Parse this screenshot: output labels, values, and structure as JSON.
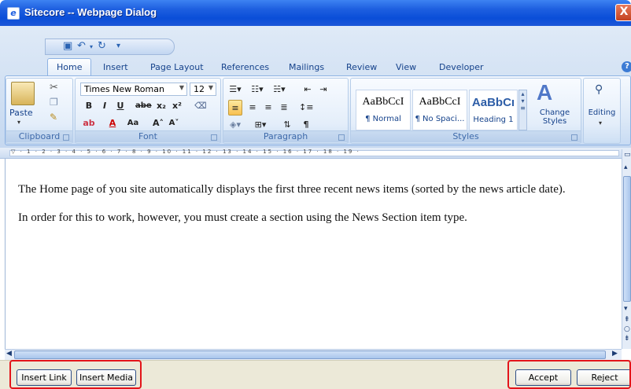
{
  "window": {
    "title": "Sitecore -- Webpage Dialog",
    "app_icon": "ie-page-icon",
    "close_glyph": "X"
  },
  "ribbon": {
    "tabs": [
      "Home",
      "Insert",
      "Page Layout",
      "References",
      "Mailings",
      "Review",
      "View",
      "Developer"
    ],
    "active_tab": "Home",
    "help_glyph": "?",
    "clipboard": {
      "label": "Clipboard",
      "paste_label": "Paste"
    },
    "font": {
      "label": "Font",
      "family": "Times New Roman",
      "size": "12",
      "bold": "B",
      "italic": "I",
      "underline": "U",
      "strike": "abe",
      "subscript": "x₂",
      "superscript": "x²",
      "grow": "A˄",
      "shrink": "A˅",
      "case": "Aa"
    },
    "paragraph": {
      "label": "Paragraph",
      "pilcrow": "¶"
    },
    "styles": {
      "label": "Styles",
      "items": [
        {
          "sample": "AaBbCcI",
          "name": "¶ Normal"
        },
        {
          "sample": "AaBbCcI",
          "name": "¶ No Spaci..."
        },
        {
          "sample": "AaBbCı",
          "name": "Heading 1"
        }
      ],
      "change_styles_label": "Change Styles"
    },
    "editing": {
      "label": "Editing"
    }
  },
  "ruler": {
    "ticks": "▽ · 1 · 2 · 3 · 4 · 5 · 6 · 7 · 8 · 9 · 10 · 11 · 12 · 13 · 14 · 15 · 16 · 17 · 18 · 19 ·"
  },
  "document": {
    "paragraphs": [
      "The Home page of you site automatically displays the first three recent news items (sorted by the news article date).",
      "In order for this to work, however, you must create a section using the News Section item type."
    ]
  },
  "footer": {
    "insert_link": "Insert Link",
    "insert_media": "Insert Media",
    "accept": "Accept",
    "reject": "Reject",
    "highlight_color": "#e3141a"
  }
}
